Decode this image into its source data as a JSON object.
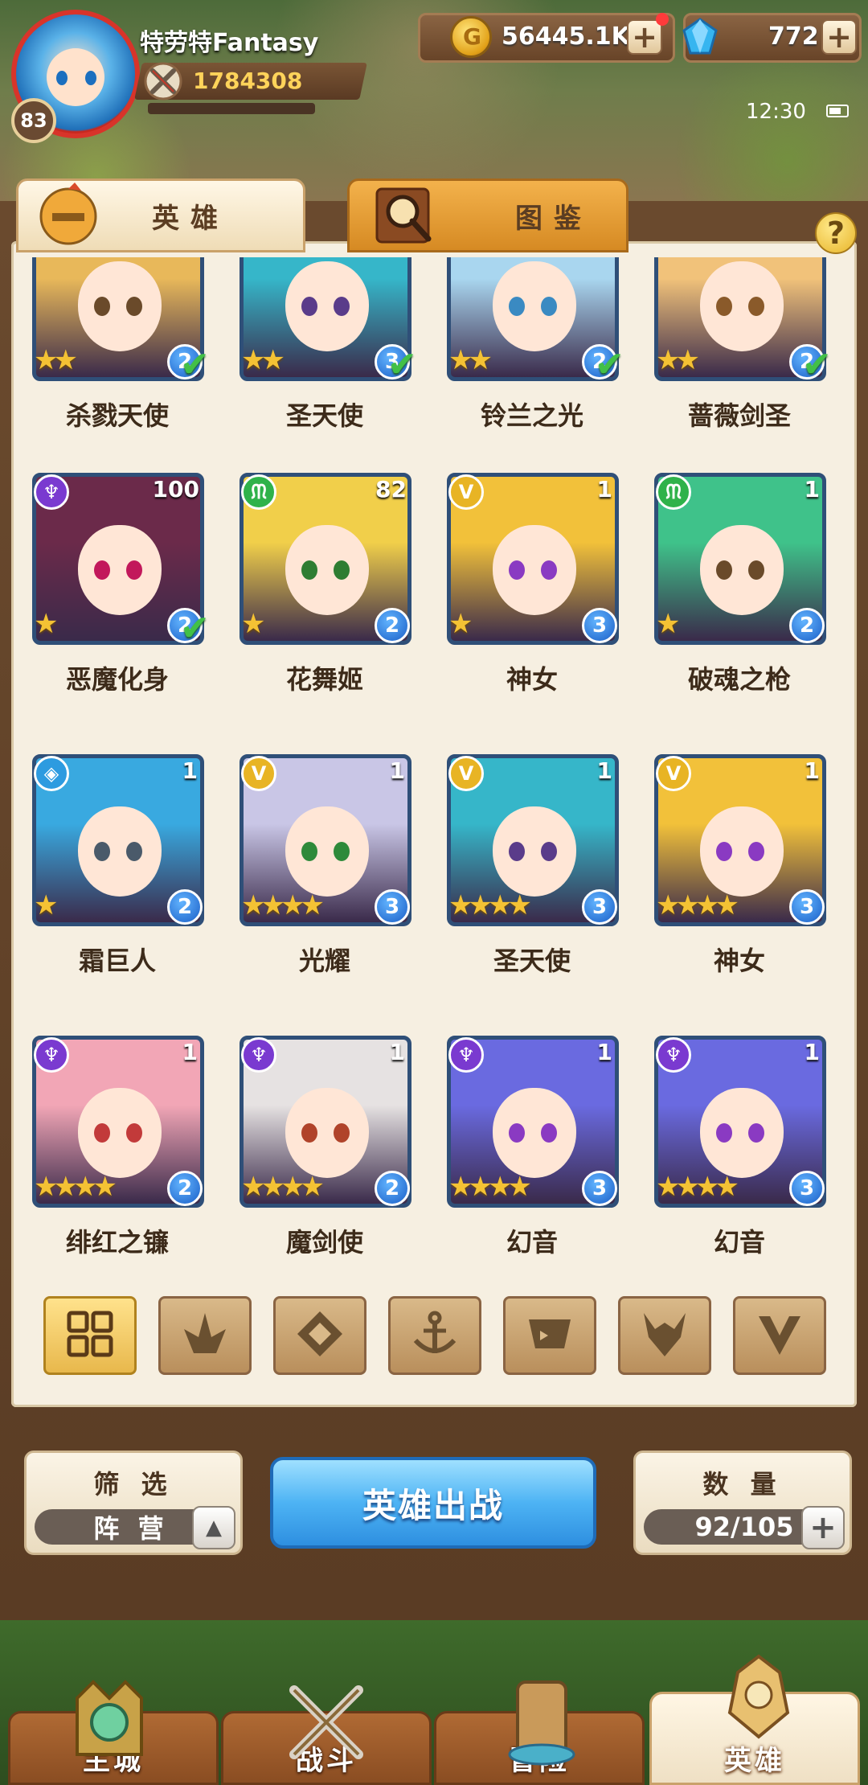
{
  "player": {
    "name": "特劳特Fantasy",
    "level": "83",
    "power": "1784308"
  },
  "resources": {
    "gold": "56445.1K",
    "gems": "772",
    "plus": "+"
  },
  "status": {
    "time": "12:30"
  },
  "tabs": [
    {
      "label": "英雄"
    },
    {
      "label": "图鉴"
    }
  ],
  "help": "?",
  "heroes": [
    {
      "name": "杀戮天使",
      "level": "",
      "rank": "2",
      "stars": "★★",
      "faction": "",
      "hair": "#e8b85a",
      "eye": "#6a4a2a",
      "checked": true,
      "cut_top": true
    },
    {
      "name": "圣天使",
      "level": "",
      "rank": "3",
      "stars": "★★",
      "faction": "",
      "hair": "#36b6c9",
      "eye": "#5a3c8a",
      "checked": true,
      "cut_top": true
    },
    {
      "name": "铃兰之光",
      "level": "",
      "rank": "2",
      "stars": "★★",
      "faction": "",
      "hair": "#a9d6ef",
      "eye": "#3a8ac2",
      "checked": true,
      "cut_top": true
    },
    {
      "name": "蔷薇剑圣",
      "level": "",
      "rank": "2",
      "stars": "★★",
      "faction": "",
      "hair": "#f1c27a",
      "eye": "#8a5a2a",
      "checked": true,
      "cut_top": true
    },
    {
      "name": "恶魔化身",
      "level": "100",
      "rank": "2",
      "stars": "★",
      "faction": "demon",
      "hair": "#6b2a4a",
      "eye": "#c2185b",
      "checked": true
    },
    {
      "name": "花舞姬",
      "level": "82",
      "rank": "2",
      "stars": "★",
      "faction": "beast",
      "hair": "#f1cf4a",
      "eye": "#2e7d32",
      "checked": false
    },
    {
      "name": "神女",
      "level": "1",
      "rank": "3",
      "stars": "★",
      "faction": "light",
      "hair": "#f2c13a",
      "eye": "#8a3ac2",
      "checked": false
    },
    {
      "name": "破魂之枪",
      "level": "1",
      "rank": "2",
      "stars": "★",
      "faction": "beast",
      "hair": "#3fc28a",
      "eye": "#6a4a2a",
      "checked": false
    },
    {
      "name": "霜巨人",
      "level": "1",
      "rank": "2",
      "stars": "★",
      "faction": "ice",
      "hair": "#39a9e0",
      "eye": "#4a5a6a",
      "checked": false
    },
    {
      "name": "光耀",
      "level": "1",
      "rank": "3",
      "stars": "★★★★",
      "faction": "light",
      "hair": "#c9c6e6",
      "eye": "#2e8a3a",
      "checked": false
    },
    {
      "name": "圣天使",
      "level": "1",
      "rank": "3",
      "stars": "★★★★",
      "faction": "light",
      "hair": "#36b6c9",
      "eye": "#5a3c8a",
      "checked": false
    },
    {
      "name": "神女",
      "level": "1",
      "rank": "3",
      "stars": "★★★★",
      "faction": "light",
      "hair": "#f2c13a",
      "eye": "#8a3ac2",
      "checked": false
    },
    {
      "name": "绯红之镰",
      "level": "1",
      "rank": "2",
      "stars": "★★★★",
      "faction": "demon",
      "hair": "#f2a6b6",
      "eye": "#c23a3a",
      "checked": false
    },
    {
      "name": "魔剑使",
      "level": "1",
      "rank": "2",
      "stars": "★★★★",
      "faction": "demon",
      "hair": "#e6e2e2",
      "eye": "#b0432a",
      "checked": false
    },
    {
      "name": "幻音",
      "level": "1",
      "rank": "3",
      "stars": "★★★★",
      "faction": "demon",
      "hair": "#6a6ae0",
      "eye": "#8a3ac2",
      "checked": false
    },
    {
      "name": "幻音",
      "level": "1",
      "rank": "3",
      "stars": "★★★★",
      "faction": "demon",
      "hair": "#6a6ae0",
      "eye": "#8a3ac2",
      "checked": false
    }
  ],
  "faction_filters": [
    {
      "name": "all-icon",
      "active": true
    },
    {
      "name": "nature-icon",
      "active": false
    },
    {
      "name": "ice-icon",
      "active": false
    },
    {
      "name": "anchor-icon",
      "active": false
    },
    {
      "name": "beast-icon",
      "active": false
    },
    {
      "name": "demon-icon",
      "active": false
    },
    {
      "name": "light-icon",
      "active": false
    }
  ],
  "filter": {
    "title": "筛 选",
    "value": "阵 营",
    "toggle": "▲"
  },
  "deploy": {
    "label": "英雄出战"
  },
  "count": {
    "title": "数 量",
    "value": "92/105",
    "plus": "+"
  },
  "nav": [
    {
      "label": "主城",
      "active": false
    },
    {
      "label": "战斗",
      "active": false
    },
    {
      "label": "冒险",
      "active": false
    },
    {
      "label": "英雄",
      "active": true
    }
  ],
  "colors": {
    "accent_gold": "#e8b84c",
    "rank_blue": "#1b5fc7",
    "check_green": "#42c047",
    "demon": "#7a3ad0",
    "beast": "#2fb24a",
    "light": "#e8b424",
    "ice": "#2d9be0"
  }
}
